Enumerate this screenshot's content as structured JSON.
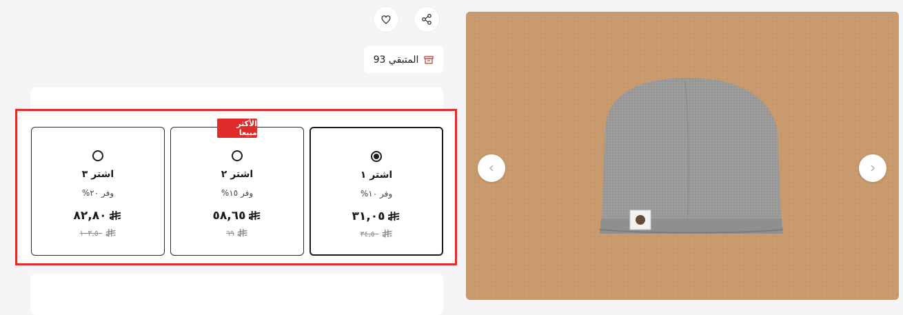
{
  "header": {
    "share_icon": "share-icon",
    "favorite_icon": "heart-icon"
  },
  "stock": {
    "label": "المتبقي 93",
    "icon": "archive-box-icon"
  },
  "gallery": {
    "prev_icon": "chevron-left-icon",
    "next_icon": "chevron-right-icon"
  },
  "bundle": {
    "best_seller_badge": "الأكثر مبيعا",
    "options": [
      {
        "title": "اشتر ١",
        "save": "وفر ١٠%",
        "price": "٣١,٠٥",
        "old_price": "٣٤,٥٠",
        "selected": true
      },
      {
        "title": "اشتر ٢",
        "save": "وفر ١٥%",
        "price": "٥٨,٦٥",
        "old_price": "٦٩",
        "selected": false
      },
      {
        "title": "اشتر ٣",
        "save": "وفر ٢٠%",
        "price": "٨٢,٨٠",
        "old_price": "١٠٣,٥٠",
        "selected": false
      }
    ]
  },
  "colors": {
    "highlight": "#e02b2b",
    "badge": "#e02b2b",
    "background": "#f5f5f7"
  }
}
